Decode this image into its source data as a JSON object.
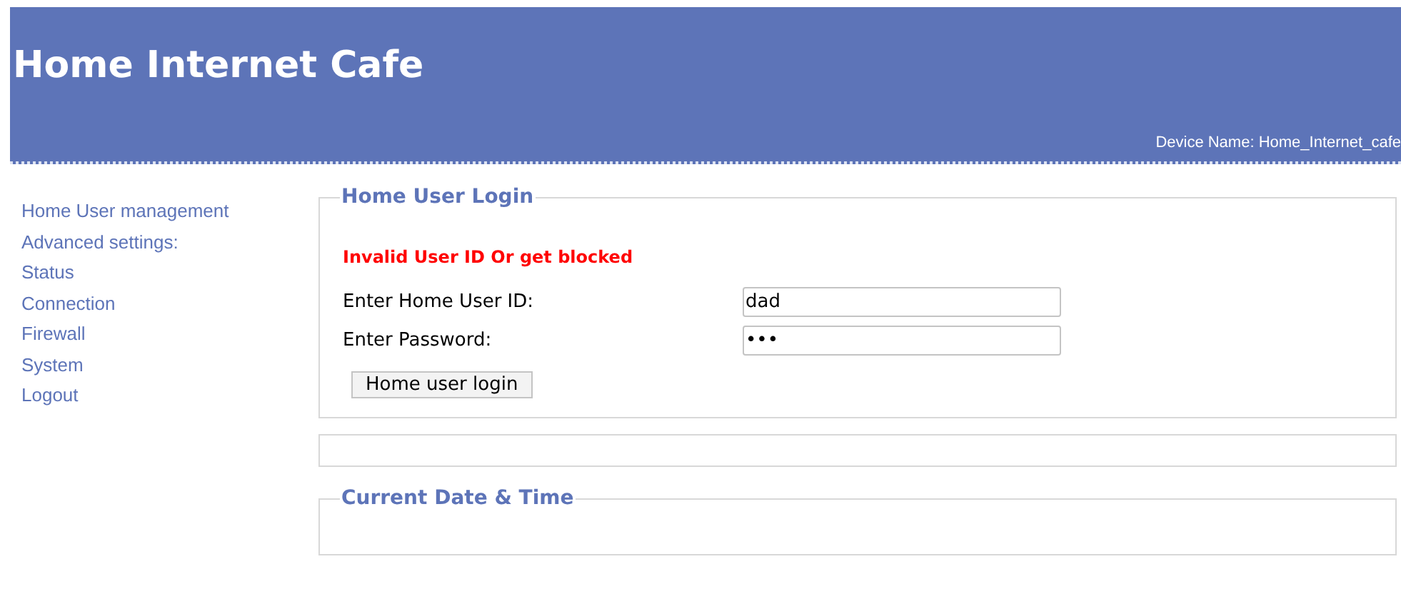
{
  "header": {
    "title": "Home Internet Cafe",
    "device_name": "Device Name: Home_Internet_cafe"
  },
  "sidebar": {
    "items": [
      {
        "label": "Home User management"
      },
      {
        "label": "Advanced settings:"
      },
      {
        "label": "Status"
      },
      {
        "label": "Connection"
      },
      {
        "label": "Firewall"
      },
      {
        "label": "System"
      },
      {
        "label": "Logout"
      }
    ]
  },
  "login": {
    "title": "Home User Login",
    "error": "Invalid User ID Or get blocked",
    "fields": [
      {
        "label": "Enter Home User ID:",
        "value": "dad"
      },
      {
        "label": "Enter Password:",
        "value": "•••"
      }
    ],
    "button": "Home user login"
  },
  "date_time": {
    "title": "Current Date & Time"
  }
}
